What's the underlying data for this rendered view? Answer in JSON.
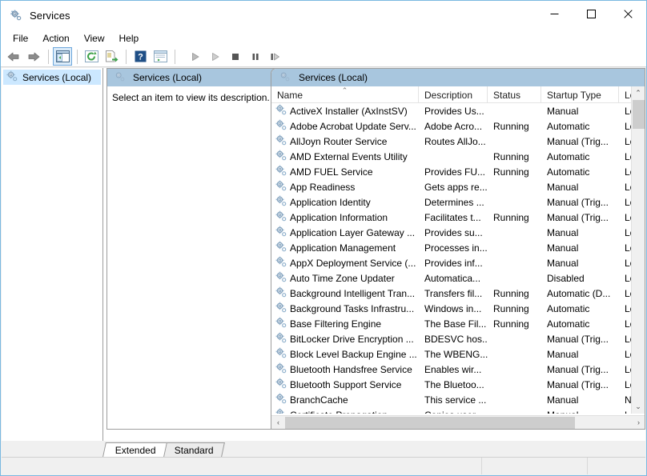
{
  "window": {
    "title": "Services",
    "icon": "services-gear-icon",
    "minimize_label": "Minimize",
    "maximize_label": "Maximize",
    "close_label": "Close"
  },
  "menu": {
    "items": [
      {
        "label": "File"
      },
      {
        "label": "Action"
      },
      {
        "label": "View"
      },
      {
        "label": "Help"
      }
    ]
  },
  "toolbar": {
    "buttons": [
      {
        "name": "back-button",
        "icon": "left-arrow-icon",
        "label": "Back"
      },
      {
        "name": "forward-button",
        "icon": "right-arrow-icon",
        "label": "Forward"
      },
      {
        "name": "show-hide-tree-button",
        "icon": "tree-pane-icon",
        "label": "Show/Hide Console Tree",
        "active": true
      },
      {
        "name": "refresh-button",
        "icon": "refresh-icon",
        "label": "Refresh"
      },
      {
        "name": "export-list-button",
        "icon": "export-list-icon",
        "label": "Export List"
      },
      {
        "name": "help-button",
        "icon": "question-mark-icon",
        "label": "Help"
      },
      {
        "name": "properties-button",
        "icon": "properties-icon",
        "label": "Properties"
      },
      {
        "name": "start-service-button",
        "icon": "play-icon",
        "label": "Start Service"
      },
      {
        "name": "restart-service-button",
        "icon": "play-outline-icon",
        "label": "Restart Service"
      },
      {
        "name": "stop-service-button",
        "icon": "stop-square-icon",
        "label": "Stop Service"
      },
      {
        "name": "pause-service-button",
        "icon": "pause-bars-icon",
        "label": "Pause Service"
      },
      {
        "name": "resume-service-button",
        "icon": "resume-icon",
        "label": "Resume Service"
      }
    ]
  },
  "tree": {
    "items": [
      {
        "label": "Services (Local)",
        "icon": "services-gear-icon",
        "selected": true
      }
    ]
  },
  "details": {
    "header": "Services (Local)",
    "header_icon": "services-gear-icon",
    "body": "Select an item to view its description."
  },
  "list": {
    "title": "Services (Local)",
    "title_icon": "services-gear-icon",
    "sort_column": "Name",
    "sort_direction": "ascending",
    "sort_caret": "⌃",
    "columns": [
      {
        "label": "Name"
      },
      {
        "label": "Description"
      },
      {
        "label": "Status"
      },
      {
        "label": "Startup Type"
      },
      {
        "label": "Log"
      }
    ],
    "rows": [
      {
        "name": "ActiveX Installer (AxInstSV)",
        "description": "Provides Us...",
        "status": "",
        "startup": "Manual",
        "logon": "Loc"
      },
      {
        "name": "Adobe Acrobat Update Serv...",
        "description": "Adobe Acro...",
        "status": "Running",
        "startup": "Automatic",
        "logon": "Loc"
      },
      {
        "name": "AllJoyn Router Service",
        "description": "Routes AllJo...",
        "status": "",
        "startup": "Manual (Trig...",
        "logon": "Loc"
      },
      {
        "name": "AMD External Events Utility",
        "description": "",
        "status": "Running",
        "startup": "Automatic",
        "logon": "Loc"
      },
      {
        "name": "AMD FUEL Service",
        "description": "Provides FU...",
        "status": "Running",
        "startup": "Automatic",
        "logon": "Loc"
      },
      {
        "name": "App Readiness",
        "description": "Gets apps re...",
        "status": "",
        "startup": "Manual",
        "logon": "Loc"
      },
      {
        "name": "Application Identity",
        "description": "Determines ...",
        "status": "",
        "startup": "Manual (Trig...",
        "logon": "Loc"
      },
      {
        "name": "Application Information",
        "description": "Facilitates t...",
        "status": "Running",
        "startup": "Manual (Trig...",
        "logon": "Loc"
      },
      {
        "name": "Application Layer Gateway ...",
        "description": "Provides su...",
        "status": "",
        "startup": "Manual",
        "logon": "Loc"
      },
      {
        "name": "Application Management",
        "description": "Processes in...",
        "status": "",
        "startup": "Manual",
        "logon": "Loc"
      },
      {
        "name": "AppX Deployment Service (...",
        "description": "Provides inf...",
        "status": "",
        "startup": "Manual",
        "logon": "Loc"
      },
      {
        "name": "Auto Time Zone Updater",
        "description": "Automatica...",
        "status": "",
        "startup": "Disabled",
        "logon": "Loc"
      },
      {
        "name": "Background Intelligent Tran...",
        "description": "Transfers fil...",
        "status": "Running",
        "startup": "Automatic (D...",
        "logon": "Loc"
      },
      {
        "name": "Background Tasks Infrastru...",
        "description": "Windows in...",
        "status": "Running",
        "startup": "Automatic",
        "logon": "Loc"
      },
      {
        "name": "Base Filtering Engine",
        "description": "The Base Fil...",
        "status": "Running",
        "startup": "Automatic",
        "logon": "Loc"
      },
      {
        "name": "BitLocker Drive Encryption ...",
        "description": "BDESVC hos...",
        "status": "",
        "startup": "Manual (Trig...",
        "logon": "Loc"
      },
      {
        "name": "Block Level Backup Engine ...",
        "description": "The WBENG...",
        "status": "",
        "startup": "Manual",
        "logon": "Loc"
      },
      {
        "name": "Bluetooth Handsfree Service",
        "description": "Enables wir...",
        "status": "",
        "startup": "Manual (Trig...",
        "logon": "Loc"
      },
      {
        "name": "Bluetooth Support Service",
        "description": "The Bluetoo...",
        "status": "",
        "startup": "Manual (Trig...",
        "logon": "Loc"
      },
      {
        "name": "BranchCache",
        "description": "This service ...",
        "status": "",
        "startup": "Manual",
        "logon": "Net"
      },
      {
        "name": "Certificate Propagation",
        "description": "Copies user ...",
        "status": "",
        "startup": "Manual",
        "logon": "Loc"
      }
    ]
  },
  "tabs": [
    {
      "label": "Extended",
      "active": true
    },
    {
      "label": "Standard",
      "active": false
    }
  ],
  "scrollbars": {
    "vertical_up": "⌃",
    "vertical_down": "⌄",
    "horizontal_left": "‹",
    "horizontal_right": "›"
  },
  "statusbar": {
    "text": ""
  },
  "colors": {
    "window_border": "#7ab8e0",
    "pane_header": "#a8c6de",
    "selection": "#cce8ff",
    "toolbar_active": "#dcecfa",
    "scroll_thumb": "#cdcdcd"
  }
}
